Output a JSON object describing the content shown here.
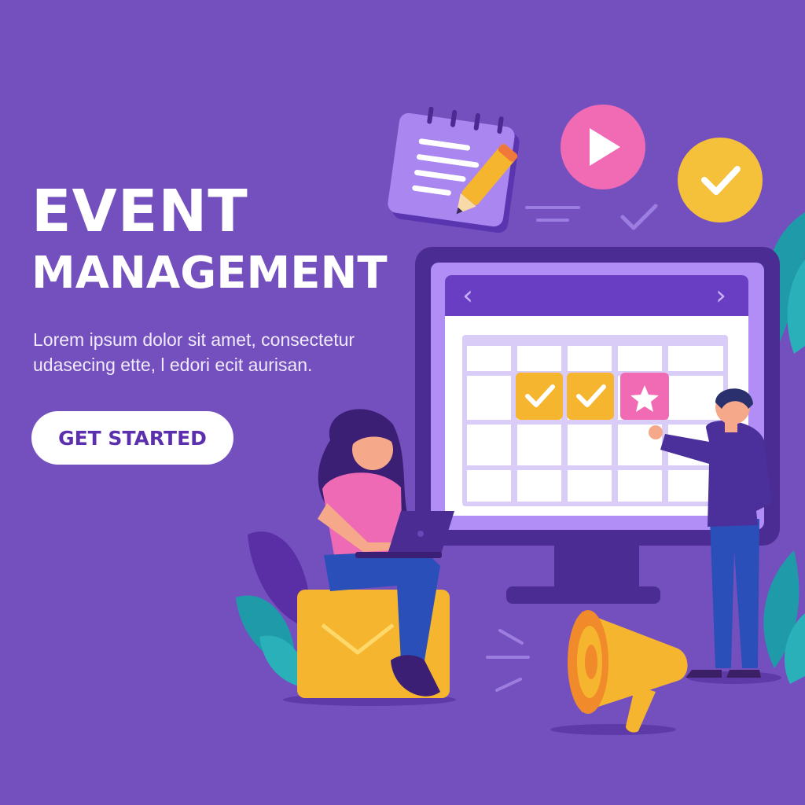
{
  "hero": {
    "title_line1": "EVENT",
    "title_line2": "MANAGEMENT",
    "description_line1": "Lorem ipsum dolor sit amet, consectetur",
    "description_line2": "udasecing ette, l edori ecit aurisan.",
    "cta_label": "GET STARTED"
  },
  "calendar": {
    "prev_arrow": "‹",
    "next_arrow": "›"
  },
  "colors": {
    "background": "#7450bf",
    "accent_yellow": "#f6b52e",
    "accent_pink": "#f06ab4",
    "monitor_frame": "#4a2c93",
    "button_text": "#5b2fae"
  },
  "icons": [
    "notepad-icon",
    "pencil-icon",
    "play-icon",
    "check-circle-icon",
    "check-icon",
    "star-icon",
    "envelope-icon",
    "megaphone-icon",
    "laptop-icon",
    "chevron-left-icon",
    "chevron-right-icon"
  ]
}
